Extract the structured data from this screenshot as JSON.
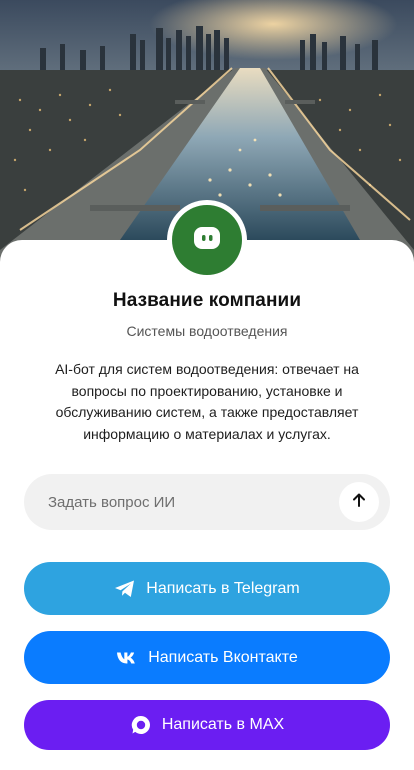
{
  "company": {
    "name": "Название компании",
    "subtitle": "Системы водоотведения",
    "description": "AI-бот для систем водоотведения: отвечает на вопросы по проектированию, установке и обслуживанию систем, а также предоставляет информацию о материалах и услугах.",
    "avatar_color": "#2e7d32"
  },
  "ask": {
    "placeholder": "Задать вопрос ИИ"
  },
  "buttons": {
    "telegram": {
      "label": "Написать в Telegram",
      "color": "#2ea3e0",
      "icon": "telegram-plane-icon"
    },
    "vk": {
      "label": "Написать Вконтакте",
      "color": "#0a7cff",
      "icon": "vk-icon"
    },
    "max": {
      "label": "Написать в MAX",
      "color": "#6b1ef2",
      "icon": "max-chat-icon"
    }
  }
}
